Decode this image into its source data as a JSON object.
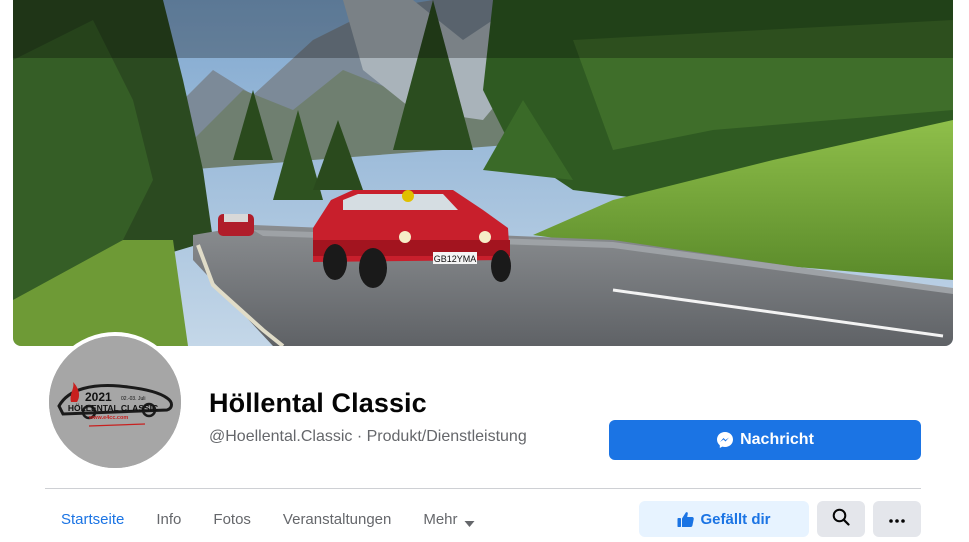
{
  "page": {
    "title": "Höllental Classic",
    "subtitle": "@Hoellental.Classic · Produkt/Dienstleistung"
  },
  "cover": {
    "description_icon": "cover-photo",
    "plate_text": "GB12YMA"
  },
  "avatar": {
    "logo_year": "2021",
    "logo_dates": "02.-03. Juli",
    "logo_name": "HÖLLENTAL CLASSIC",
    "logo_url": "www.e4cc.com"
  },
  "actions": {
    "message_label": "Nachricht",
    "like_label": "Gefällt dir",
    "message_icon": "messenger-icon",
    "like_icon": "thumbs-up-icon",
    "search_icon": "search-icon",
    "more_icon": "more-icon"
  },
  "tabs": [
    {
      "label": "Startseite",
      "active": true
    },
    {
      "label": "Info",
      "active": false
    },
    {
      "label": "Fotos",
      "active": false
    },
    {
      "label": "Veranstaltungen",
      "active": false
    },
    {
      "label": "Mehr",
      "active": false
    }
  ],
  "colors": {
    "accent": "#1b74e4",
    "accent_light": "#e7f3ff",
    "secondary_button": "#e4e6eb",
    "text_primary": "#050505",
    "text_secondary": "#65676b"
  }
}
